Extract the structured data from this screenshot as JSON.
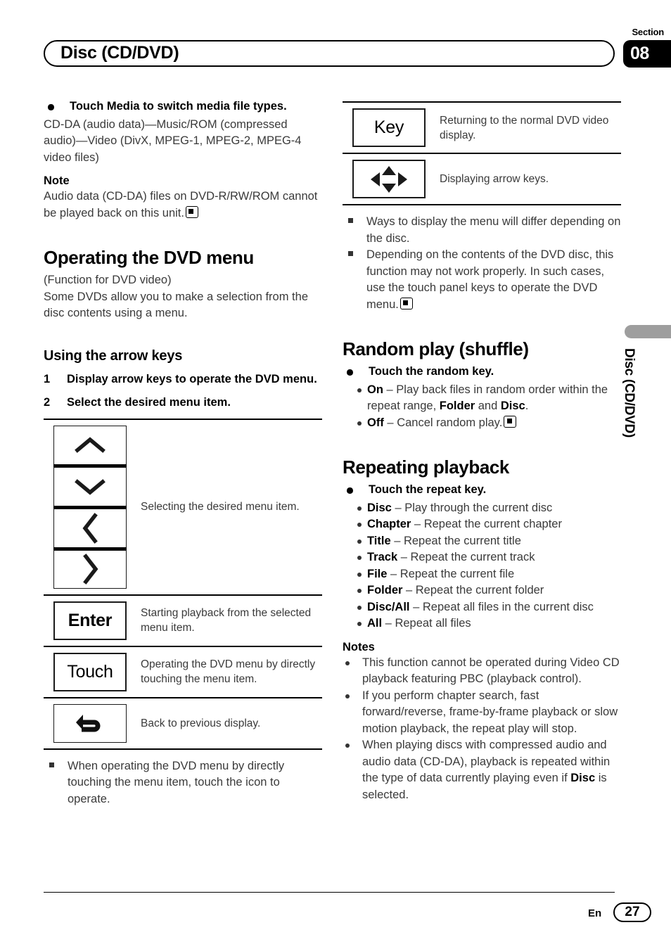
{
  "header": {
    "title": "Disc (CD/DVD)",
    "section_label": "Section",
    "section_number": "08"
  },
  "side_tab": {
    "text": "Disc (CD/DVD)"
  },
  "footer": {
    "language": "En",
    "page_number": "27"
  },
  "left_column": {
    "media_bullet": "Touch Media to switch media file types.",
    "media_body": "CD-DA (audio data)—Music/ROM (compressed audio)—Video (DivX, MPEG-1, MPEG-2, MPEG-4 video files)",
    "note_label": "Note",
    "note_body": "Audio data (CD-DA) files on DVD-R/RW/ROM cannot be played back on this unit.",
    "section_title": "Operating the DVD menu",
    "section_sub1": "(Function for DVD video)",
    "section_sub2": "Some DVDs allow you to make a selection from the disc contents using a menu.",
    "subsection_title": "Using the arrow keys",
    "steps": [
      {
        "num": "1",
        "text": "Display arrow keys to operate the DVD menu."
      },
      {
        "num": "2",
        "text": "Select the desired menu item."
      }
    ],
    "key_table": [
      {
        "icon": "arrow-keys-stack",
        "labels": [
          "chevron-up-icon",
          "chevron-down-icon",
          "chevron-left-icon",
          "chevron-right-icon"
        ],
        "desc": "Selecting the desired menu item."
      },
      {
        "icon": "text",
        "label": "Enter",
        "desc": "Starting playback from the selected menu item."
      },
      {
        "icon": "text",
        "label": "Touch",
        "desc": "Operating the DVD menu by directly touching the menu item."
      },
      {
        "icon": "back-arrow-icon",
        "label": "",
        "desc": "Back to previous display."
      }
    ],
    "remark": "When operating the DVD menu by directly touching the menu item, touch the icon to operate."
  },
  "right_column": {
    "key_table": [
      {
        "icon": "text",
        "label": "Key",
        "desc": "Returning to the normal DVD video display."
      },
      {
        "icon": "four-way-arrow-icon",
        "label": "",
        "desc": "Displaying arrow keys."
      }
    ],
    "remarks": [
      "Ways to display the menu will differ depending on the disc.",
      "Depending on the contents of the DVD disc, this function may not work properly. In such cases, use the touch panel keys to operate the DVD menu."
    ],
    "random_title": "Random play (shuffle)",
    "random_bullet": "Touch the random key.",
    "random_items": [
      {
        "term": "On",
        "dash": " – ",
        "desc_pre": "Play back files in random order within the repeat range, ",
        "bold_a": "Folder",
        "mid": " and ",
        "bold_b": "Disc",
        "desc_post": ".",
        "end": false
      },
      {
        "term": "Off",
        "dash": " – ",
        "desc_pre": "Cancel random play.",
        "bold_a": "",
        "mid": "",
        "bold_b": "",
        "desc_post": "",
        "end": true
      }
    ],
    "repeat_title": "Repeating playback",
    "repeat_bullet": "Touch the repeat key.",
    "repeat_items": [
      {
        "term": "Disc",
        "desc": " – Play through the current disc"
      },
      {
        "term": "Chapter",
        "desc": " – Repeat the current chapter"
      },
      {
        "term": "Title",
        "desc": " – Repeat the current title"
      },
      {
        "term": "Track",
        "desc": " – Repeat the current track"
      },
      {
        "term": "File",
        "desc": " – Repeat the current file"
      },
      {
        "term": "Folder",
        "desc": " – Repeat the current folder"
      },
      {
        "term": "Disc/All",
        "desc": " – Repeat all files in the current disc"
      },
      {
        "term": "All",
        "desc": " – Repeat all files"
      }
    ],
    "notes_label": "Notes",
    "notes": [
      "This function cannot be operated during Video CD playback featuring PBC (playback control).",
      "If you perform chapter search, fast forward/reverse, frame-by-frame playback or slow motion playback, the repeat play will stop.",
      "When playing discs with compressed audio and audio data (CD-DA), playback is repeated within the type of data currently playing even if "
    ],
    "notes_last_bold": "Disc",
    "notes_last_tail": " is selected."
  }
}
